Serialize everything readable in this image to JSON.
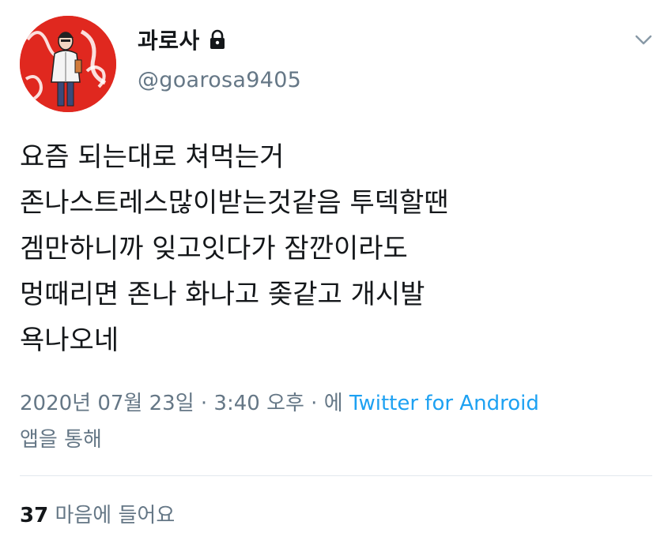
{
  "colors": {
    "text_primary": "#14171a",
    "text_secondary": "#657786",
    "link": "#1da1f2",
    "divider": "#e1e8ed",
    "avatar_bg": "#e0281f"
  },
  "user": {
    "display_name": "과로사",
    "handle": "@goarosa9405",
    "protected_icon": "lock-icon",
    "avatar_icon": "avatar"
  },
  "tweet": {
    "lines": [
      "요즘 되는대로 쳐먹는거",
      "존나스트레스많이받는것같음  투덱할땐",
      "겜만하니까 잊고잇다가 잠깐이라도",
      "멍때리면 존나 화나고 좆같고 개시발",
      "욕나오네"
    ]
  },
  "meta": {
    "timestamp": "2020년 07월 23일 · 3:40 오후 · 에",
    "source": "Twitter for Android",
    "source_suffix": "앱을 통해"
  },
  "stats": {
    "likes_count": "37",
    "likes_label": "마음에 들어요"
  },
  "more_icon": "chevron-down-icon"
}
